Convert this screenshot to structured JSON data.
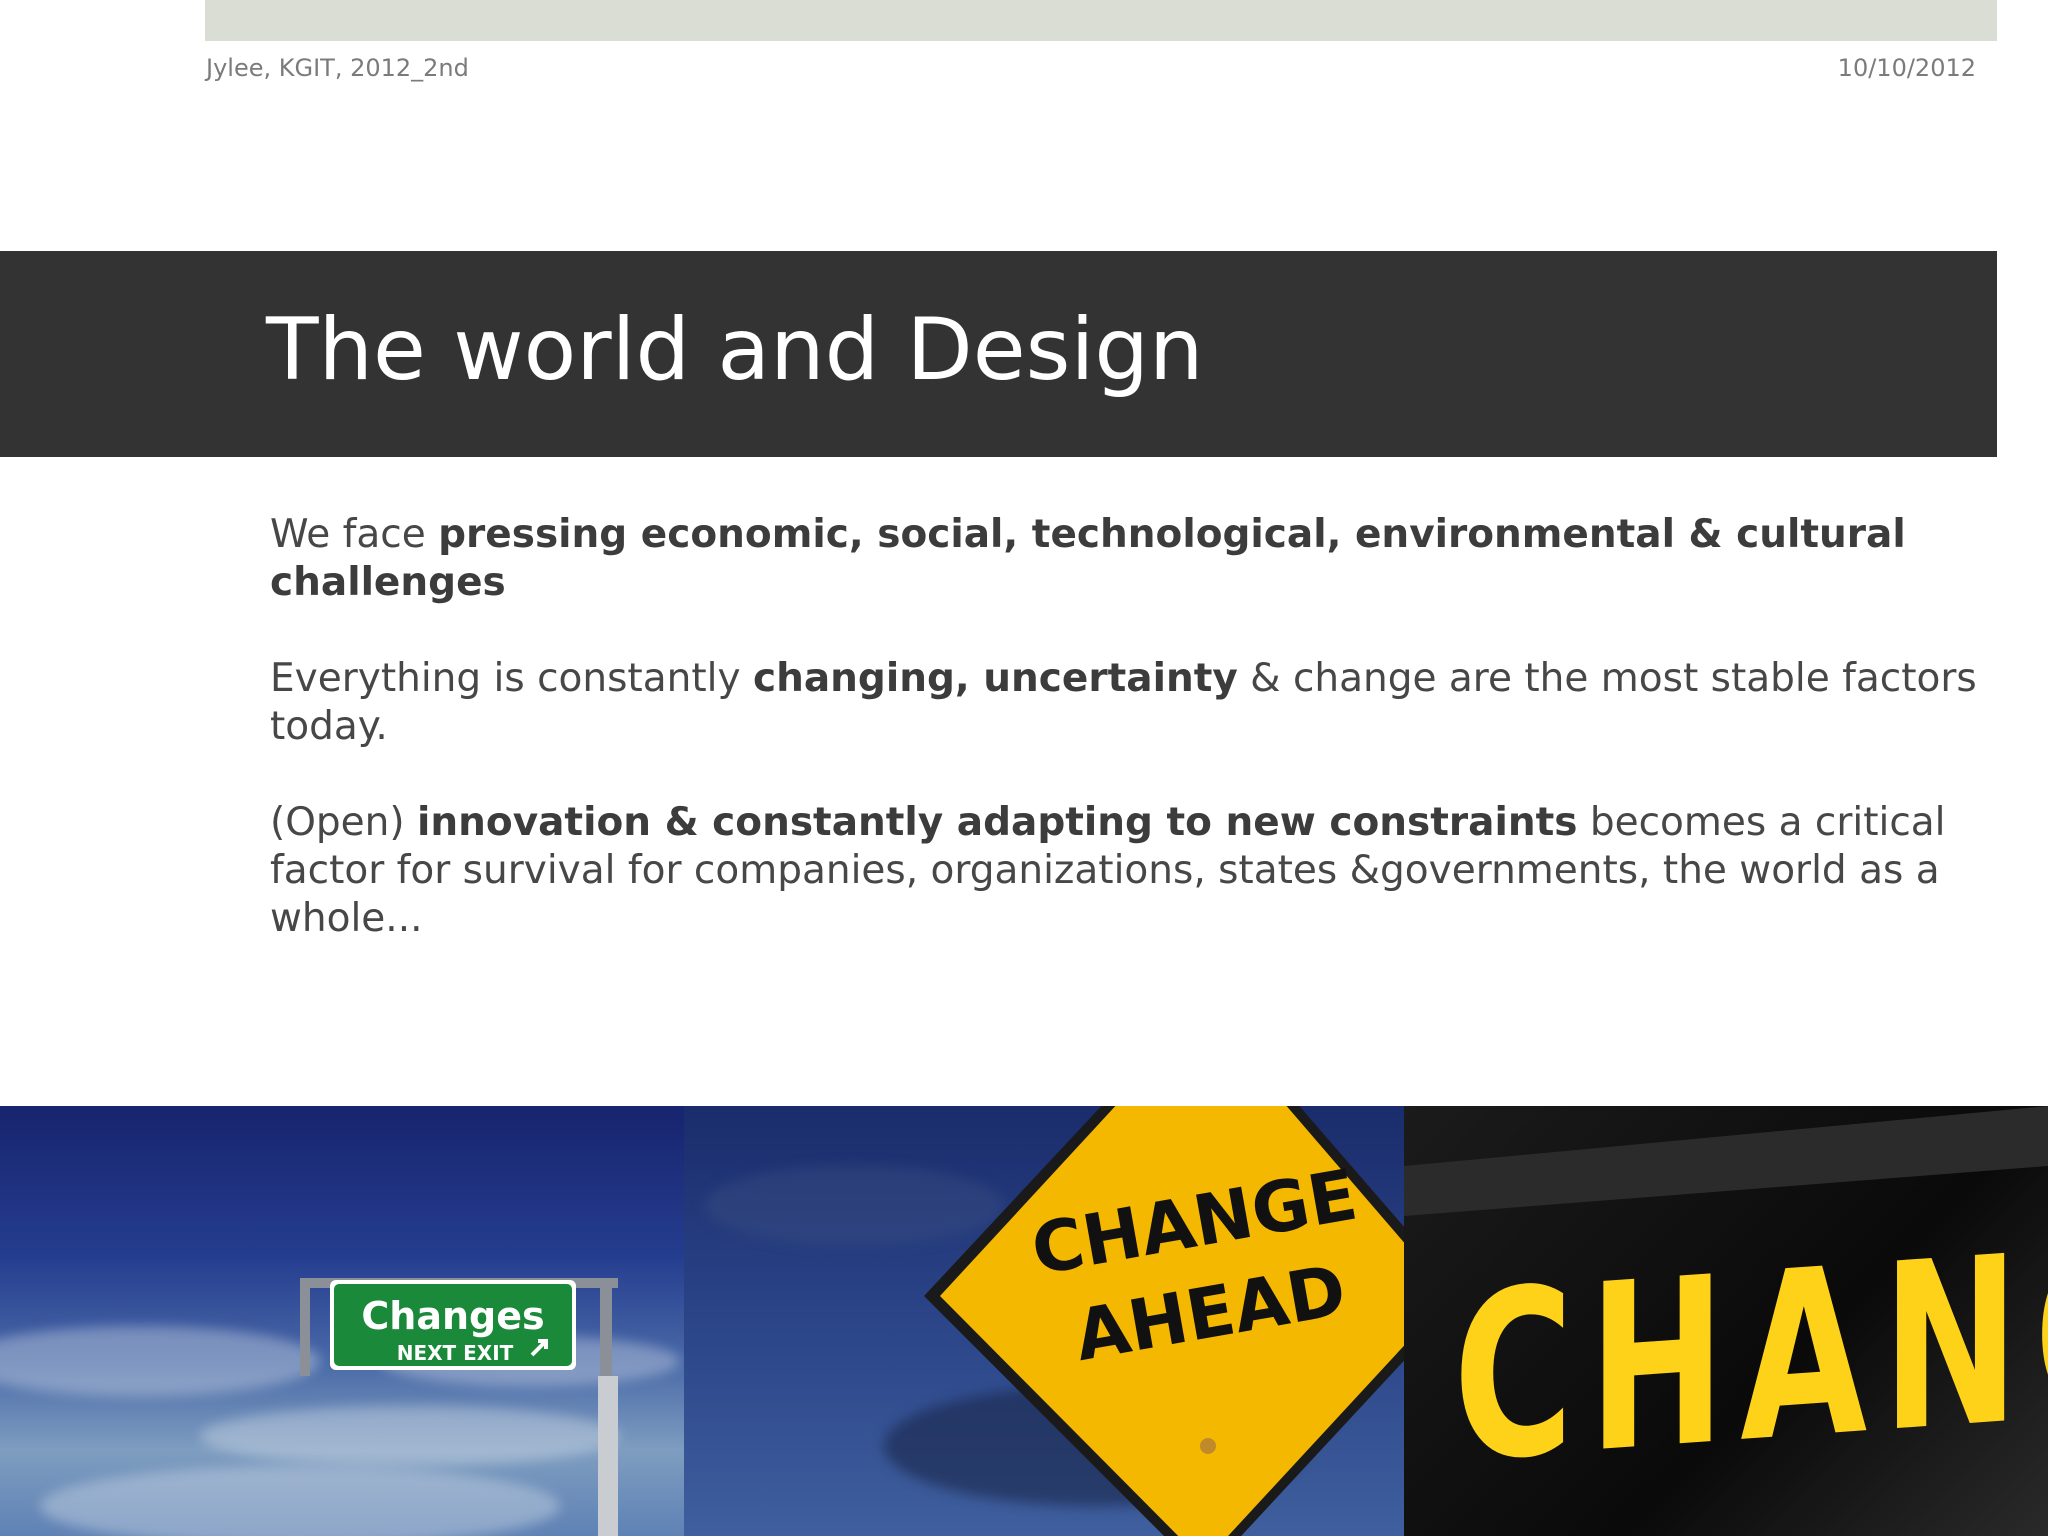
{
  "header": {
    "author": "Jylee, KGIT, 2012_2nd",
    "date": "10/10/2012"
  },
  "slide": {
    "title": "The world and Design",
    "paragraphs": [
      {
        "p1_pre": "We face ",
        "p1_bold": "pressing economic, social, technological, environmental & cultural challenges"
      },
      {
        "p2_pre": "Everything is constantly ",
        "p2_bold": "changing, uncertainty",
        "p2_post": " & change are the most stable factors today."
      },
      {
        "p3_pre": "(Open) ",
        "p3_bold": "innovation & constantly adapting to new constraints",
        "p3_post": " becomes a critical factor for survival for companies, organizations, states &governments, the world as a whole..."
      }
    ]
  },
  "images": {
    "highway_sign": {
      "line1": "Changes",
      "line2": "NEXT EXIT"
    },
    "diamond_sign": {
      "line1": "CHANGE",
      "line2": "AHEAD"
    },
    "stencil_sign": {
      "text": "CHANGE"
    }
  },
  "colors": {
    "title_band": "#333333",
    "top_band": "#d9ddd4",
    "sign_green": "#1a8a3a",
    "sign_yellow": "#f5b800",
    "stencil_yellow": "#ffd21a"
  }
}
